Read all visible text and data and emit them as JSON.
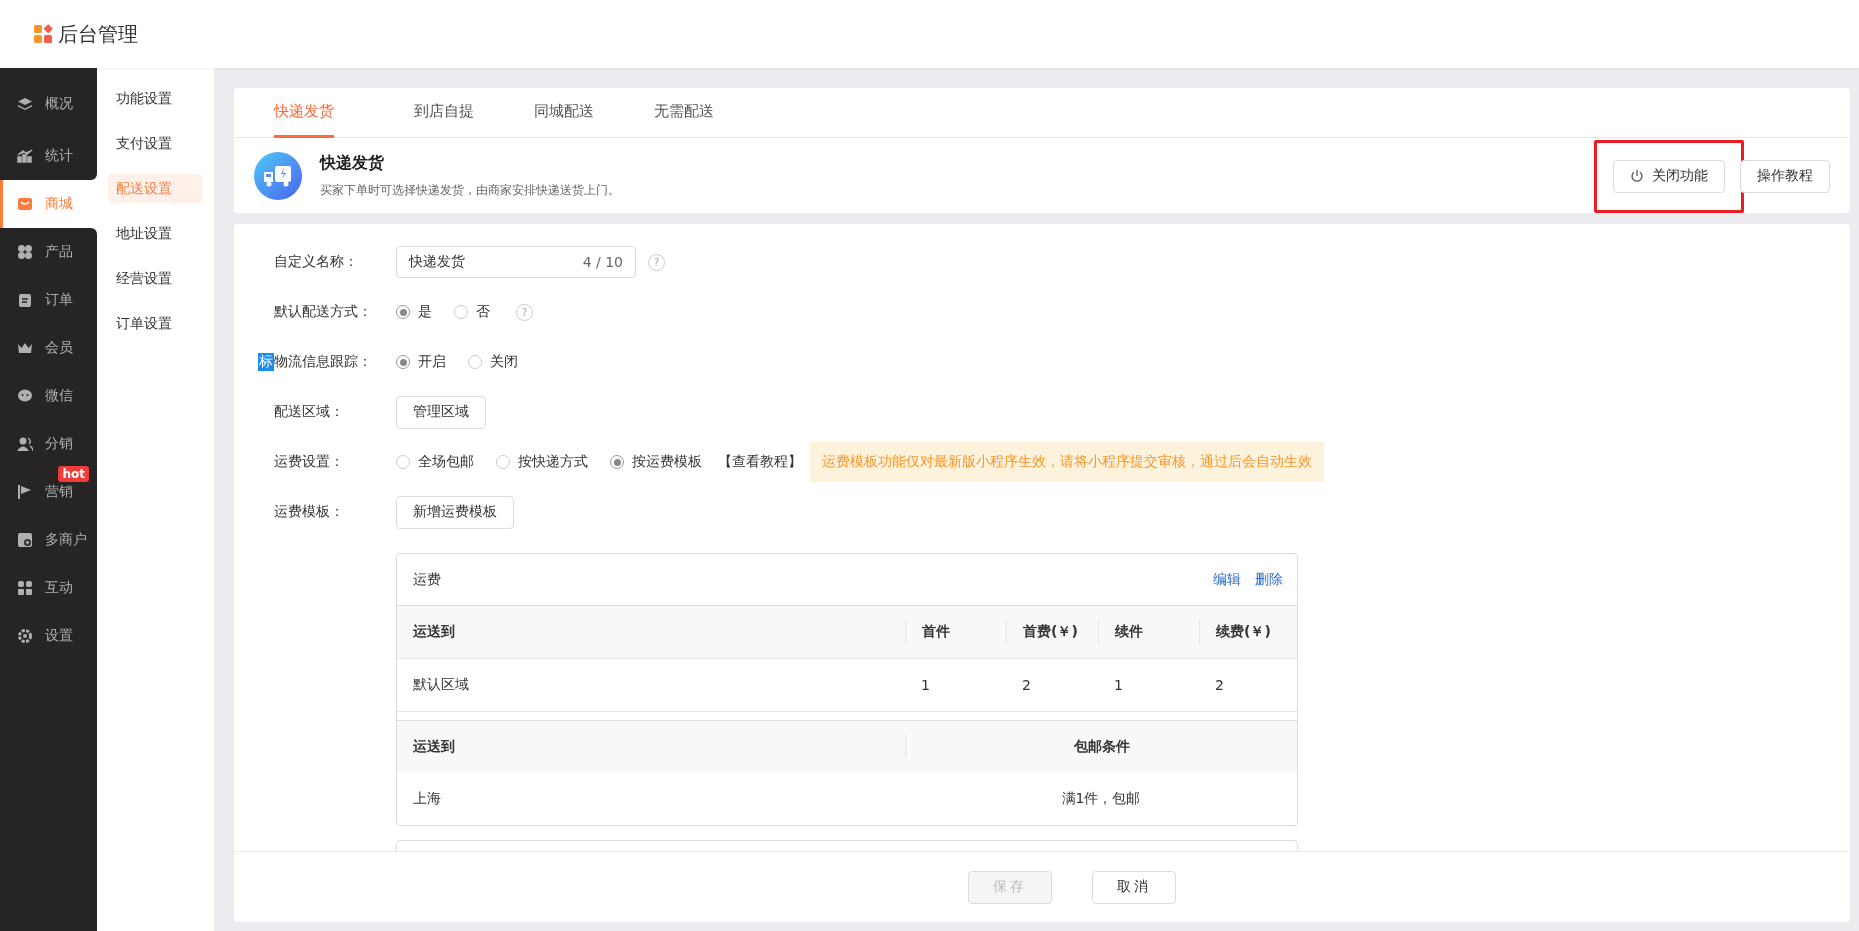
{
  "app": {
    "title": "后台管理"
  },
  "nav": [
    {
      "label": "概况",
      "selected": false
    },
    {
      "label": "统计",
      "selected": false
    },
    {
      "label": "商城",
      "selected": true
    },
    {
      "label": "产品",
      "selected": false
    },
    {
      "label": "订单",
      "selected": false
    },
    {
      "label": "会员",
      "selected": false
    },
    {
      "label": "微信",
      "selected": false
    },
    {
      "label": "分销",
      "selected": false
    },
    {
      "label": "营销",
      "selected": false,
      "badge": "hot"
    },
    {
      "label": "多商户",
      "selected": false
    },
    {
      "label": "互动",
      "selected": false
    },
    {
      "label": "设置",
      "selected": false
    }
  ],
  "subnav": [
    {
      "label": "功能设置",
      "selected": false
    },
    {
      "label": "支付设置",
      "selected": false
    },
    {
      "label": "配送设置",
      "selected": true
    },
    {
      "label": "地址设置",
      "selected": false
    },
    {
      "label": "经营设置",
      "selected": false
    },
    {
      "label": "订单设置",
      "selected": false
    }
  ],
  "tabs": [
    {
      "label": "快递发货",
      "selected": true
    },
    {
      "label": "到店自提",
      "selected": false
    },
    {
      "label": "同城配送",
      "selected": false
    },
    {
      "label": "无需配送",
      "selected": false
    }
  ],
  "feature": {
    "title": "快递发货",
    "description": "买家下单时可选择快递发货，由商家安排快递送货上门。",
    "buttons": [
      {
        "label": "关闭功能",
        "kind": "power",
        "highlighted": true
      },
      {
        "label": "操作教程",
        "kind": "plain",
        "highlighted": false
      }
    ]
  },
  "form": [
    {
      "kind": "text",
      "label": "自定义名称：",
      "value": "快递发货",
      "counter": "4 / 10",
      "help": "?"
    },
    {
      "kind": "radio",
      "label": "默认配送方式：",
      "options": [
        {
          "label": "是",
          "selected": true
        },
        {
          "label": "否",
          "selected": false
        }
      ],
      "help": "?"
    },
    {
      "kind": "radio",
      "label": "物流信息跟踪：",
      "tag": "标",
      "options": [
        {
          "label": "开启",
          "selected": true
        },
        {
          "label": "关闭",
          "selected": false
        }
      ]
    },
    {
      "kind": "button",
      "label": "配送区域：",
      "button": "管理区域"
    },
    {
      "kind": "radio",
      "label": "运费设置：",
      "options": [
        {
          "label": "全场包邮",
          "selected": false
        },
        {
          "label": "按快递方式",
          "selected": false
        },
        {
          "label": "按运费模板",
          "selected": true
        }
      ],
      "link": "【查看教程】",
      "notice": "运费模板功能仅对最新版小程序生效，请将小程序提交审核，通过后会自动生效"
    },
    {
      "kind": "button",
      "label": "运费模板：",
      "button": "新增运费模板"
    }
  ],
  "templates": [
    {
      "name": "运费",
      "actions": [
        "编辑",
        "删除"
      ],
      "fee_columns": [
        "运送到",
        "首件",
        "首费(￥)",
        "续件",
        "续费(￥)"
      ],
      "fee_rows": [
        [
          "默认区域",
          "1",
          "2",
          "1",
          "2"
        ]
      ],
      "free_columns": [
        "运送到",
        "包邮条件"
      ],
      "free_rows": [
        [
          "上海",
          "满1件，包邮"
        ]
      ]
    }
  ],
  "footer": {
    "buttons": [
      {
        "label": "保存",
        "disabled": true
      },
      {
        "label": "取消",
        "disabled": false
      }
    ]
  }
}
